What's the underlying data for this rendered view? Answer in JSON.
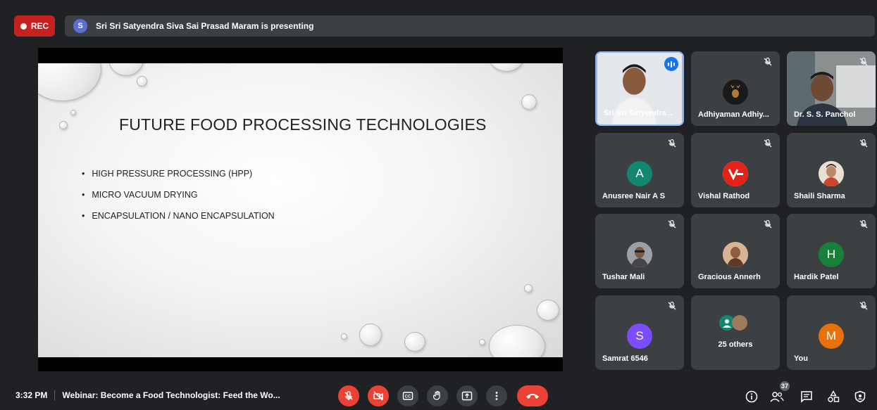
{
  "top_bar": {
    "rec_label": "REC",
    "presenter_initial": "S",
    "presenting_text": "Sri Sri Satyendra Siva Sai Prasad Maram is presenting"
  },
  "slide": {
    "title": "FUTURE FOOD PROCESSING TECHNOLOGIES",
    "bullets": [
      "HIGH PRESSURE PROCESSING (HPP)",
      "MICRO VACUUM DRYING",
      "ENCAPSULATION / NANO ENCAPSULATION"
    ]
  },
  "participants": [
    {
      "name": "Sri Sri Satyendra...",
      "type": "video",
      "speaking": true
    },
    {
      "name": "Adhiyaman Adhiy...",
      "type": "avatar-image",
      "muted": true
    },
    {
      "name": "Dr. S. S. Panchol",
      "type": "video",
      "muted": true
    },
    {
      "name": "Anusree Nair A S",
      "type": "initial",
      "initial": "A",
      "color": "#12866e",
      "muted": true
    },
    {
      "name": "Vishal Rathod",
      "type": "avatar-image",
      "muted": true
    },
    {
      "name": "Shaili Sharma",
      "type": "avatar-image",
      "muted": true
    },
    {
      "name": "Tushar Mali",
      "type": "avatar-image",
      "muted": true
    },
    {
      "name": "Gracious Annerh",
      "type": "avatar-image",
      "muted": true
    },
    {
      "name": "Hardik Patel",
      "type": "initial",
      "initial": "H",
      "color": "#188038",
      "muted": true
    },
    {
      "name": "Samrat 6546",
      "type": "initial",
      "initial": "S",
      "color": "#7c4dff",
      "muted": true
    },
    {
      "name": "25 others",
      "type": "others"
    },
    {
      "name": "You",
      "type": "initial",
      "initial": "M",
      "color": "#e8710a",
      "muted": true
    }
  ],
  "bottom_bar": {
    "time": "3:32 PM",
    "meeting_title": "Webinar: Become a Food Technologist: Feed the Wo...",
    "participant_count": "37"
  },
  "colors": {
    "background": "#202124",
    "tile": "#3c4043",
    "danger": "#ea4335",
    "accent": "#8ab4f8"
  },
  "icons": [
    "mic-off-icon",
    "camera-off-icon",
    "captions-icon",
    "raise-hand-icon",
    "present-icon",
    "more-options-icon",
    "leave-call-icon",
    "info-icon",
    "people-icon",
    "chat-icon",
    "activities-icon",
    "host-controls-icon"
  ]
}
